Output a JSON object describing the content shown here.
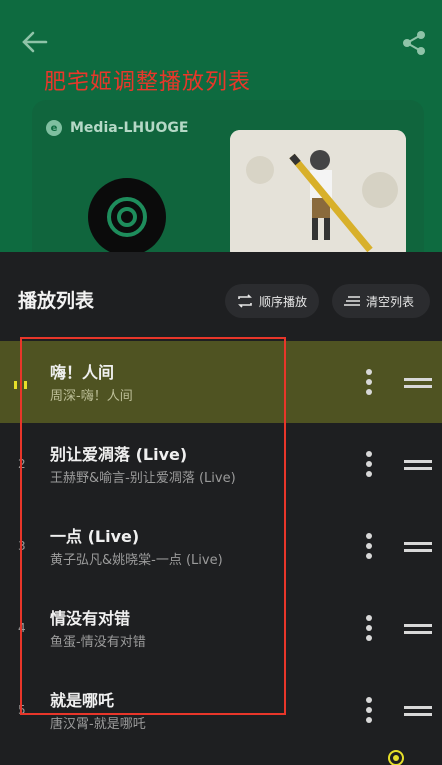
{
  "header": {
    "back_icon": "arrow-left-icon",
    "share_icon": "share-icon",
    "annotation_title": "肥宅姬调整播放列表"
  },
  "media": {
    "source_label": "Media-LHUOGE",
    "source_icon": "media-logo-icon"
  },
  "playlist": {
    "title": "播放列表",
    "order_label": "顺序播放",
    "clear_label": "清空列表",
    "items": [
      {
        "index": "",
        "title": "嗨！人间",
        "subtitle": "周深-嗨！人间",
        "playing": true
      },
      {
        "index": "2",
        "title": "别让爱凋落 (Live)",
        "subtitle": "王赫野&喻言-别让爱凋落 (Live)",
        "playing": false
      },
      {
        "index": "3",
        "title": "一点 (Live)",
        "subtitle": "黄子弘凡&姚晓棠-一点 (Live)",
        "playing": false
      },
      {
        "index": "4",
        "title": "情没有对错",
        "subtitle": "鱼蛋-情没有对错",
        "playing": false
      },
      {
        "index": "5",
        "title": "就是哪吒",
        "subtitle": "唐汉霄-就是哪吒",
        "playing": false
      }
    ]
  },
  "colors": {
    "header_green": "#0e6b40",
    "sheet_bg": "#1e1f21",
    "active_row": "#4f5322",
    "annotation_red": "#e9372a"
  }
}
